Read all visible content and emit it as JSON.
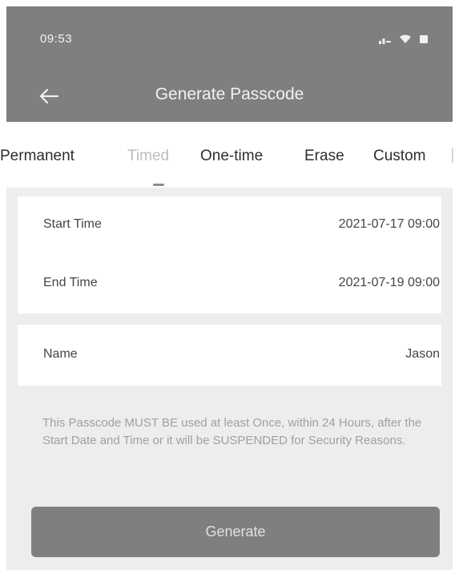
{
  "status_bar": {
    "time": "09:53"
  },
  "header": {
    "title": "Generate Passcode",
    "back_icon": "arrow-left-icon"
  },
  "tabs": [
    {
      "label": "Permanent",
      "active": false
    },
    {
      "label": "Timed",
      "active": true
    },
    {
      "label": "One-time",
      "active": false
    },
    {
      "label": "Erase",
      "active": false
    },
    {
      "label": "Custom",
      "active": false
    }
  ],
  "time_settings": {
    "start_label": "Start Time",
    "start_value": "2021-07-17 09:00",
    "end_label": "End Time",
    "end_value": "2021-07-19 09:00"
  },
  "name_setting": {
    "label": "Name",
    "value": "Jason"
  },
  "notice": "This Passcode MUST BE used at least Once, within 24 Hours, after the Start Date and Time or it will be SUSPENDED for Security Reasons.",
  "generate_button": {
    "label": "Generate"
  },
  "colors": {
    "bar": "#7f7f7f",
    "page_background": "#ededed",
    "card_background": "#ffffff",
    "active_tab": "#bdbdbd",
    "text": "#454545"
  },
  "icons": {
    "signal": "signal-icon",
    "wifi": "wifi-icon",
    "battery": "battery-icon"
  }
}
